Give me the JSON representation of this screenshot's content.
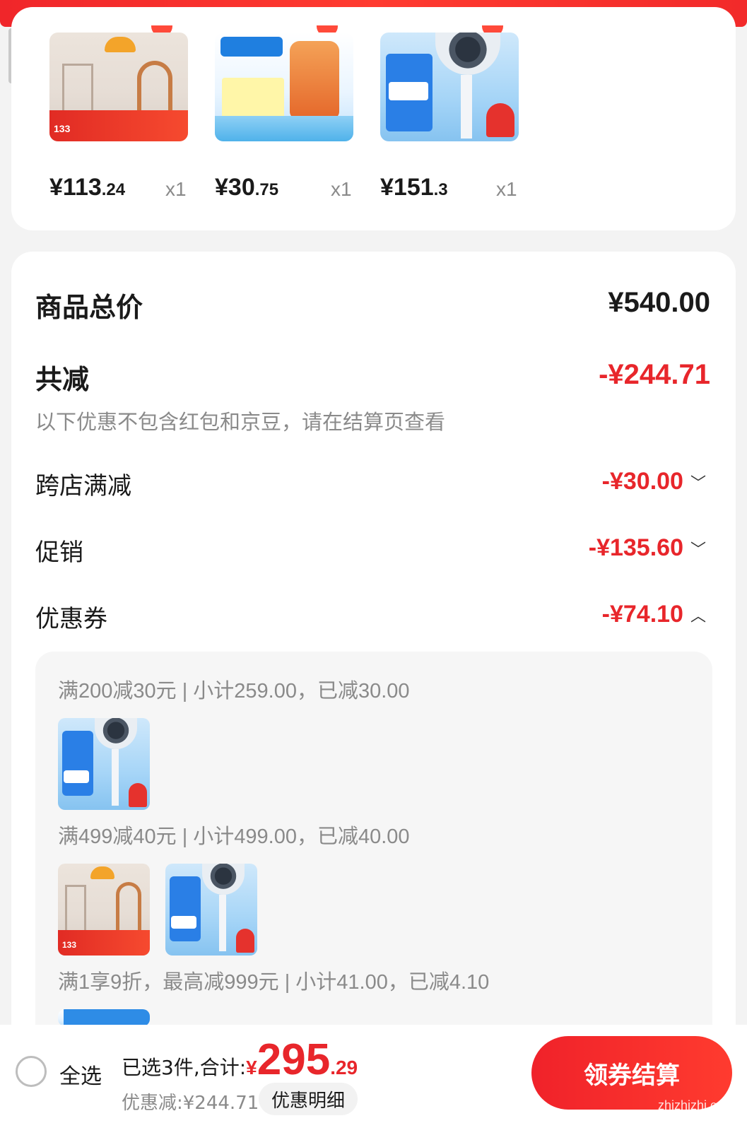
{
  "top_products": [
    {
      "image": "ceiling-light-product-image",
      "price_int": "¥113",
      "price_dec": ".24",
      "qty": "x1"
    },
    {
      "image": "cold-medicine-product-image",
      "price_int": "¥30",
      "price_dec": ".75",
      "qty": "x1"
    },
    {
      "image": "air-circulator-fan-product-image",
      "price_int": "¥151",
      "price_dec": ".3",
      "qty": "x1"
    }
  ],
  "summary": {
    "total_label": "商品总价",
    "total_value": "¥540.00",
    "reduce_label": "共减",
    "reduce_value": "-¥244.71",
    "hint": "以下优惠不包含红包和京豆，请在结算页查看",
    "rows": [
      {
        "label": "跨店满减",
        "value": "-¥30.00",
        "expanded": false
      },
      {
        "label": "促销",
        "value": "-¥135.60",
        "expanded": false
      },
      {
        "label": "优惠券",
        "value": "-¥74.10",
        "expanded": true
      }
    ]
  },
  "coupon_details": [
    {
      "rule": "满200减30元 | 小计259.00，已减30.00",
      "items": [
        "air-circulator-fan-product-image"
      ]
    },
    {
      "rule": "满499减40元 | 小计499.00，已减40.00",
      "items": [
        "ceiling-light-product-image",
        "air-circulator-fan-product-image"
      ]
    },
    {
      "rule": "满1享9折，最高减999元 | 小计41.00，已减4.10",
      "items": [
        "cold-medicine-product-image"
      ]
    }
  ],
  "bottom_bar": {
    "select_all": "全选",
    "total_label": "已选3件,合计:",
    "currency": "¥",
    "total_int": "295",
    "total_dec": ".29",
    "discount": "优惠减:¥244.71",
    "detail_button": "优惠明细",
    "checkout_button": "领券结算",
    "watermark": "zhizhizhi.com"
  },
  "colors": {
    "accent_red": "#e8262b",
    "muted_text": "#8a8a8a"
  }
}
